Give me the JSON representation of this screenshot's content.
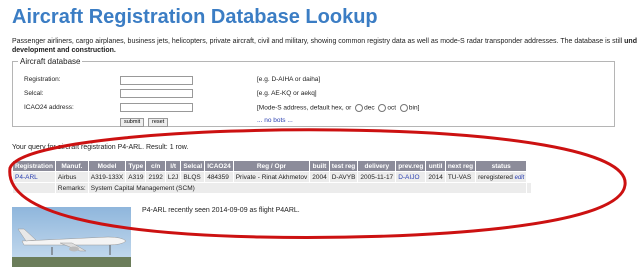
{
  "page": {
    "title": "Aircraft Registration Database Lookup",
    "intro_text": "Passenger airliners, cargo airplanes, business jets, helicopters, private aircraft, civil and military, showing common registry data as well as mode-S radar transponder addresses. The database is still",
    "intro_bold_1": "und",
    "intro_bold_2": "development and construction."
  },
  "search": {
    "legend": "Aircraft database",
    "registration_label": "Registration:",
    "registration_value": "",
    "registration_hint": "[e.g. D-AIHA or daiha]",
    "selcal_label": "Selcal:",
    "selcal_value": "",
    "selcal_hint": "[e.g. AE-KQ or aekq]",
    "icao_label": "ICAO24 address:",
    "icao_value": "",
    "icao_hint": "[Mode-S address, default hex, or",
    "radio_dec": "dec",
    "radio_oct": "oct",
    "radio_bin": "bin]",
    "no_bots": "... no bots ...",
    "submit_label": "submit",
    "reset_label": "reset"
  },
  "query_text": "Your query for aircraft registration P4-ARL. Result: 1 row.",
  "results": {
    "headers": [
      "Registration",
      "Manuf.",
      "Model",
      "Type",
      "c/n",
      "l/t",
      "Selcal",
      "ICAO24",
      "Reg / Opr",
      "built",
      "test reg",
      "delivery",
      "prev.reg",
      "until",
      "next reg",
      "status"
    ],
    "row": [
      "P4-ARL",
      "Airbus",
      "A319-133X",
      "A319",
      "2192",
      "L2J",
      "BLQS",
      "484359",
      "Private - Rinat Akhmetov",
      "2004",
      "D-AVYB",
      "2005-11-17",
      "D-AIJO",
      "2014",
      "TU-VAS",
      "reregistered"
    ],
    "edit_label": "edit",
    "remarks_label": "Remarks:",
    "remarks_value": "System Capital Management (SCM)"
  },
  "seen_text": "P4-ARL recently seen 2014-09-09 as flight P4ARL.",
  "colors": {
    "title": "#3b7dc4",
    "header_bg": "#8c8c9a",
    "row_bg": "#ececec",
    "link": "#2a3fb0",
    "ellipse": "#cc1111"
  }
}
